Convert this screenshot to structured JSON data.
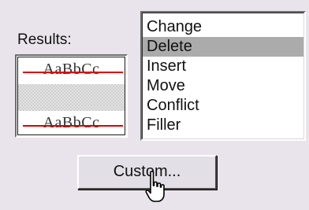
{
  "results": {
    "label": "Results:",
    "sample_text_top": "AaBbCc",
    "sample_text_bottom": "AaBbCc",
    "strike_color": "#e00000"
  },
  "list": {
    "items": [
      {
        "label": "Change",
        "selected": false
      },
      {
        "label": "Delete",
        "selected": true
      },
      {
        "label": "Insert",
        "selected": false
      },
      {
        "label": "Move",
        "selected": false
      },
      {
        "label": "Conflict",
        "selected": false
      },
      {
        "label": "Filler",
        "selected": false
      }
    ],
    "selection_color": "#ababab"
  },
  "custom_button": {
    "label": "Custom..."
  },
  "cursor": {
    "icon": "hand-pointer-icon"
  }
}
